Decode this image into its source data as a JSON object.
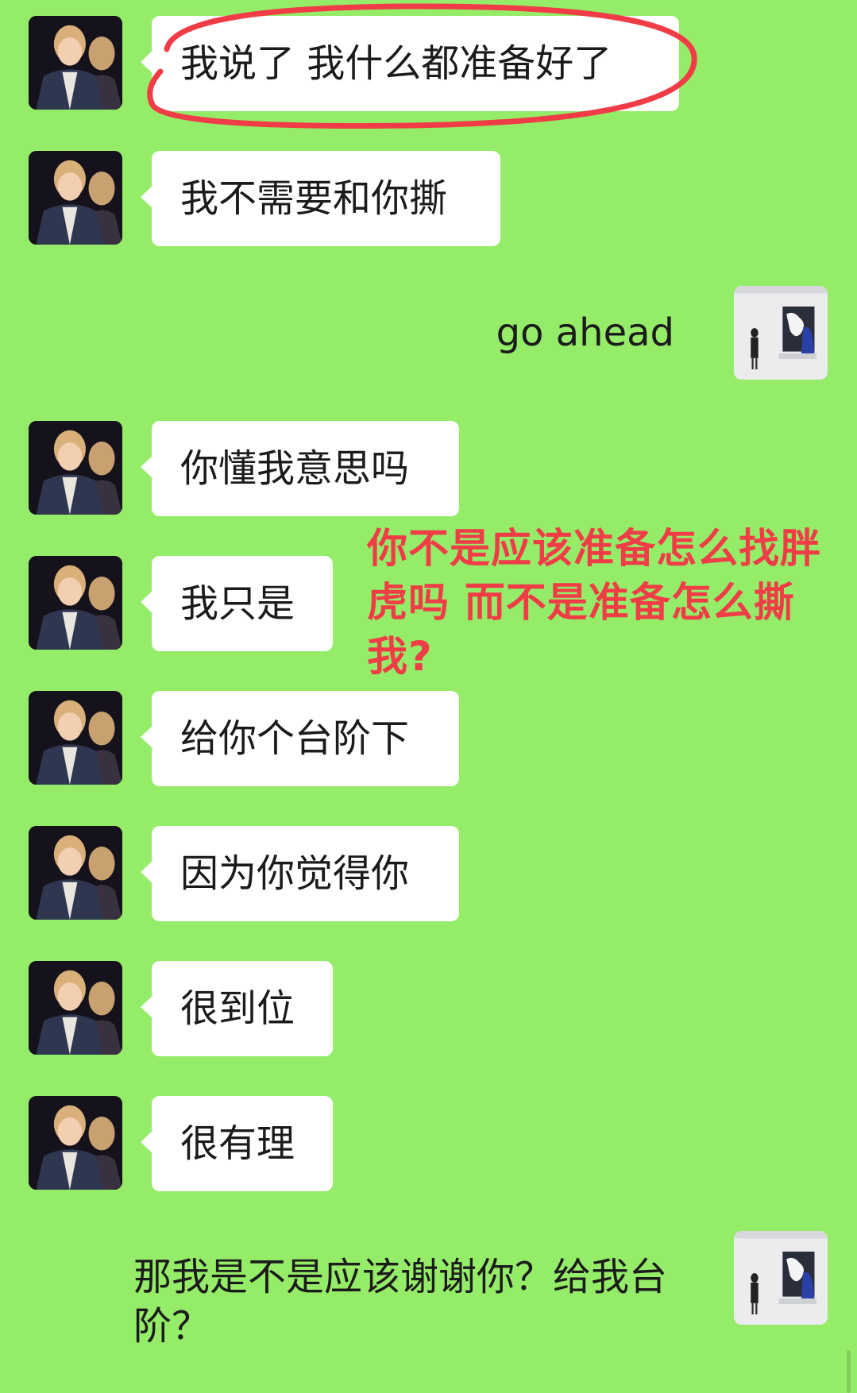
{
  "messages": [
    {
      "side": "left",
      "text": "我说了 我什么都准备好了"
    },
    {
      "side": "left",
      "text": "我不需要和你撕"
    },
    {
      "side": "right",
      "text": "go ahead"
    },
    {
      "side": "left",
      "text": "你懂我意思吗"
    },
    {
      "side": "left",
      "text": "我只是"
    },
    {
      "side": "left",
      "text": "给你个台阶下"
    },
    {
      "side": "left",
      "text": "因为你觉得你"
    },
    {
      "side": "left",
      "text": "很到位"
    },
    {
      "side": "left",
      "text": "很有理"
    },
    {
      "side": "right",
      "text": "那我是不是应该谢谢你？给我台阶？"
    }
  ],
  "annotation": {
    "text": "你不是应该准备怎么找胖虎吗 而不是准备怎么撕我?",
    "color": "#f03c46"
  },
  "colors": {
    "background": "#95ec69",
    "bubble": "#ffffff",
    "circle": "#f03c46"
  },
  "icons": {
    "contact_avatar": "contact-avatar-photo",
    "self_avatar": "self-avatar-photo"
  }
}
